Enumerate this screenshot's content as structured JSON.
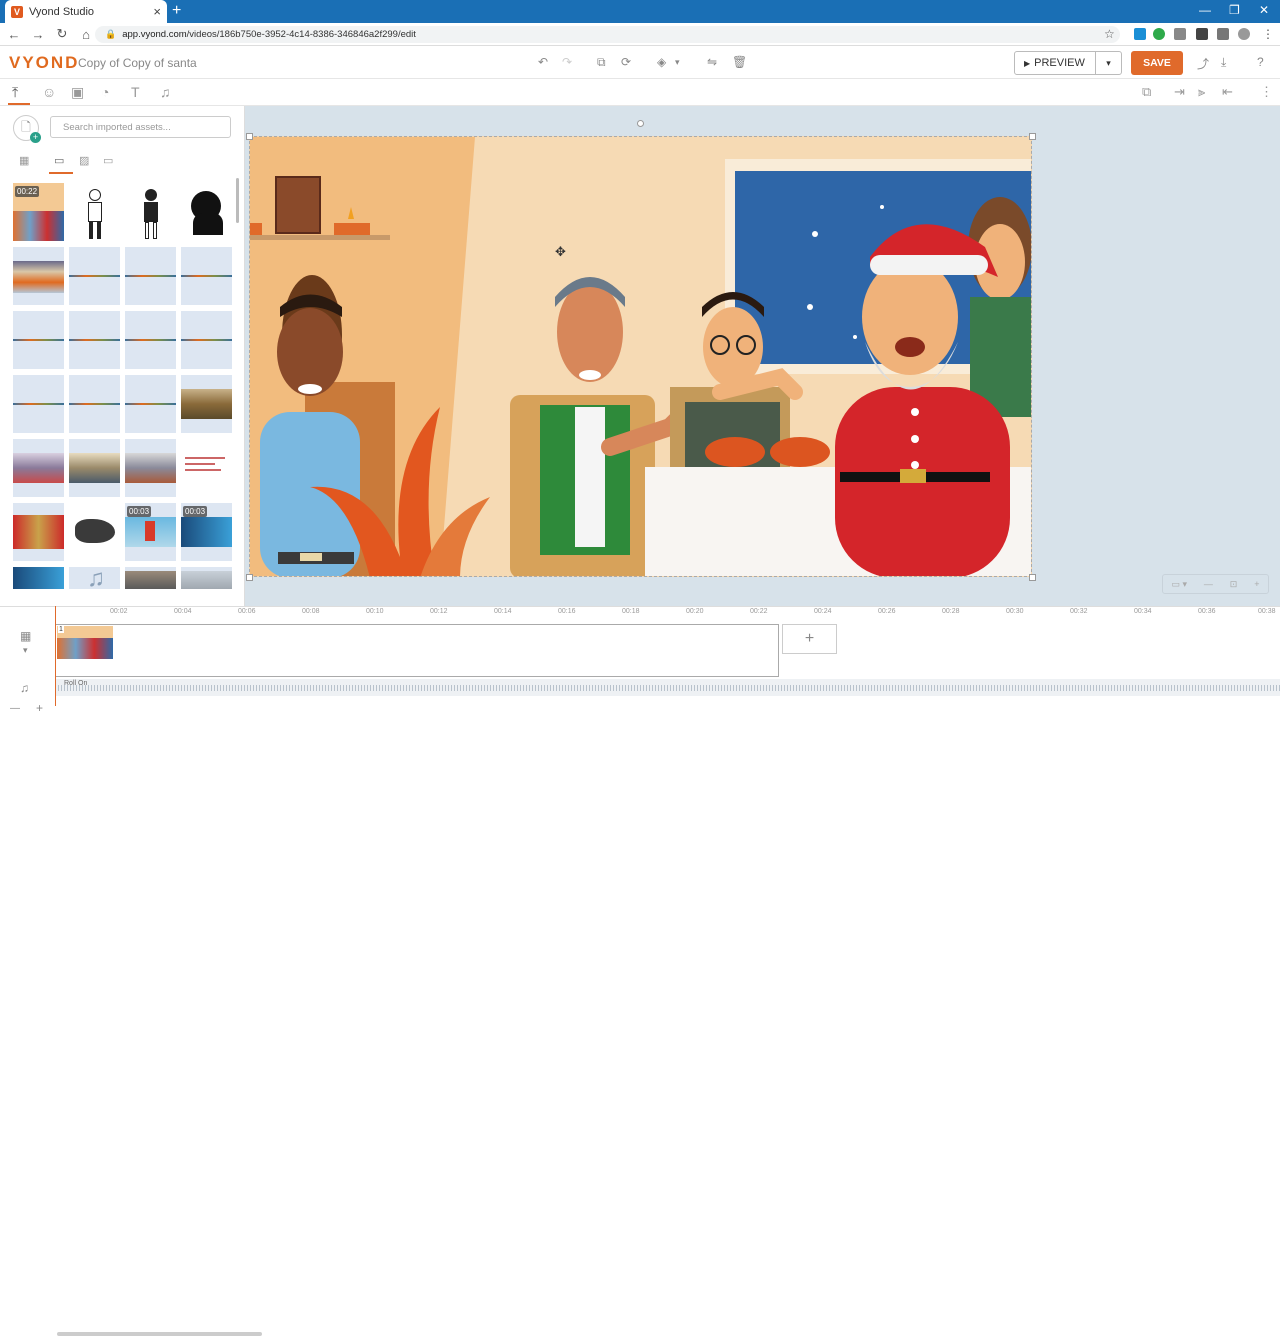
{
  "browser": {
    "tab_title": "Vyond Studio",
    "tab_favicon": "V",
    "url_host": "app.vyond.com",
    "url_path": "/videos/186b750e-3952-4c14-8386-346846a2f299/edit"
  },
  "app": {
    "logo": "VYOND",
    "title": "Copy of Copy of santa",
    "preview_label": "PREVIEW",
    "save_label": "SAVE",
    "brand_color": "#e06a2b"
  },
  "assets": {
    "search_placeholder": "Search imported assets...",
    "durations": [
      "00:22",
      "00:03",
      "00:03"
    ]
  },
  "ruler": {
    "ticks": [
      "00:02",
      "00:04",
      "00:06",
      "00:08",
      "00:10",
      "00:12",
      "00:14",
      "00:16",
      "00:18",
      "00:20",
      "00:22",
      "00:24",
      "00:26",
      "00:28",
      "00:30",
      "00:32",
      "00:34",
      "00:36",
      "00:38"
    ]
  },
  "timeline": {
    "scene_number": "1",
    "add_symbol": "+",
    "audio_label": "Roll On"
  }
}
